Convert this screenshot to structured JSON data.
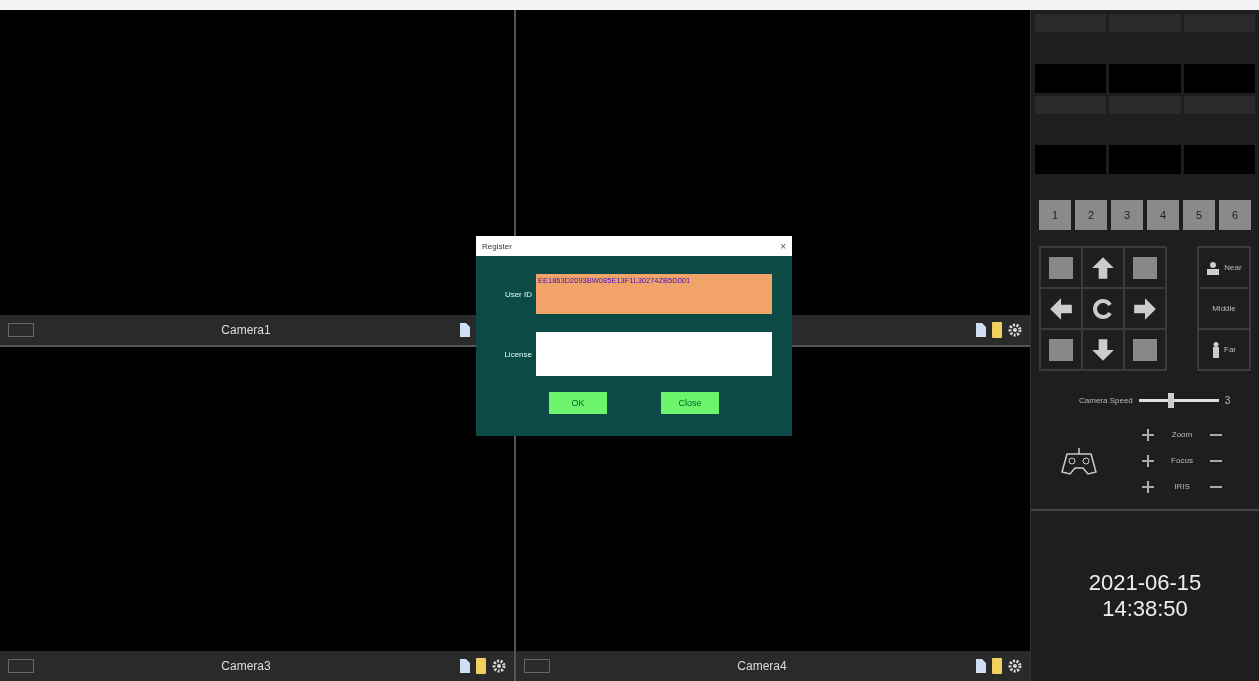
{
  "cameras": [
    {
      "kind": "labeled",
      "label": "Camera1"
    },
    {
      "kind": "unlabeled"
    },
    {
      "kind": "labeled",
      "label": "Camera3"
    },
    {
      "kind": "labeled",
      "label": "Camera4"
    }
  ],
  "dialog": {
    "title": "Register",
    "close": "×",
    "user_id_label": "User ID",
    "user_id_value": "EE1863D2093BW085E13F1L30274ZB5D001",
    "license_label": "License",
    "buttons": [
      "OK",
      "Close"
    ]
  },
  "presets": [
    "1",
    "2",
    "3",
    "4",
    "5",
    "6"
  ],
  "distance_buttons": [
    {
      "kind": "near",
      "label": "Near"
    },
    {
      "kind": "middle",
      "label": "Middle"
    },
    {
      "kind": "far",
      "label": "Far"
    }
  ],
  "speed": {
    "label": "Camera Speed",
    "level": 0.4,
    "reading": "3"
  },
  "lens": [
    {
      "label": "Zoom"
    },
    {
      "label": "Focus"
    },
    {
      "label": "IRIS"
    }
  ],
  "clock": {
    "date": "2021-06-15",
    "time": "14:38:50"
  }
}
